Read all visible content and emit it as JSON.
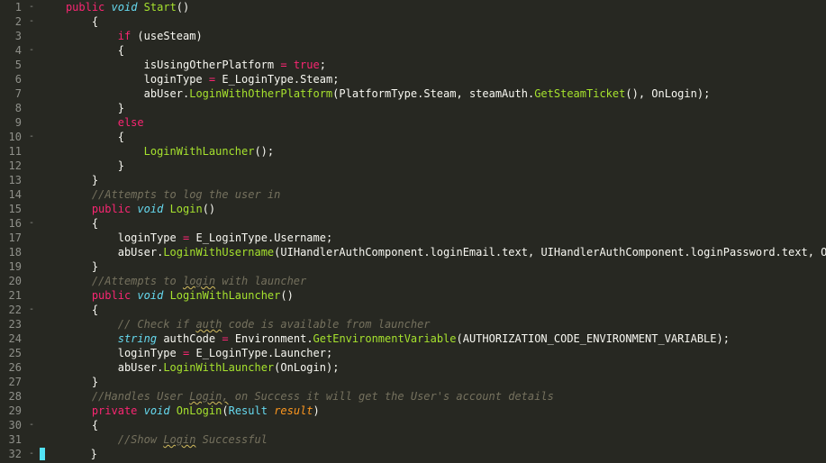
{
  "editor": {
    "language": "csharp",
    "theme": "monokai",
    "lines": [
      {
        "n": 1,
        "fold": "-",
        "html": "    <span class='kw'>public</span> <span class='type'>void</span> <span class='func'>Start</span><span class='paren'>()</span>"
      },
      {
        "n": 2,
        "fold": "-",
        "html": "        <span class='punc'>{</span>"
      },
      {
        "n": 3,
        "fold": "",
        "html": "            <span class='kw'>if</span> <span class='paren'>(</span><span class='ident'>useSteam</span><span class='paren'>)</span>"
      },
      {
        "n": 4,
        "fold": "-",
        "html": "            <span class='punc'>{</span>"
      },
      {
        "n": 5,
        "fold": "",
        "html": "                <span class='ident'>isUsingOtherPlatform</span> <span class='op'>=</span> <span class='kw'>true</span><span class='punc'>;</span>"
      },
      {
        "n": 6,
        "fold": "",
        "html": "                <span class='ident'>loginType</span> <span class='op'>=</span> <span class='ident'>E_LoginType</span><span class='punc'>.</span><span class='ident'>Steam</span><span class='punc'>;</span>"
      },
      {
        "n": 7,
        "fold": "",
        "html": "                <span class='ident'>abUser</span><span class='punc'>.</span><span class='func'>LoginWithOtherPlatform</span><span class='paren'>(</span><span class='ident'>PlatformType</span><span class='punc'>.</span><span class='ident'>Steam</span><span class='punc'>,</span> <span class='ident'>steamAuth</span><span class='punc'>.</span><span class='func'>GetSteamTicket</span><span class='paren'>()</span><span class='punc'>,</span> <span class='ident'>OnLogin</span><span class='paren'>)</span><span class='punc'>;</span>"
      },
      {
        "n": 8,
        "fold": "",
        "html": "            <span class='punc'>}</span>"
      },
      {
        "n": 9,
        "fold": "",
        "html": "            <span class='kw'>else</span>"
      },
      {
        "n": 10,
        "fold": "-",
        "html": "            <span class='punc'>{</span>"
      },
      {
        "n": 11,
        "fold": "",
        "html": "                <span class='func'>LoginWithLauncher</span><span class='paren'>()</span><span class='punc'>;</span>"
      },
      {
        "n": 12,
        "fold": "",
        "html": "            <span class='punc'>}</span>"
      },
      {
        "n": 13,
        "fold": "",
        "html": "        <span class='punc'>}</span>"
      },
      {
        "n": 14,
        "fold": "",
        "html": "        <span class='cmt'>//Attempts to log the user in</span>"
      },
      {
        "n": 15,
        "fold": "",
        "html": "        <span class='kw'>public</span> <span class='type'>void</span> <span class='func'>Login</span><span class='paren'>()</span>"
      },
      {
        "n": 16,
        "fold": "-",
        "html": "        <span class='punc'>{</span>"
      },
      {
        "n": 17,
        "fold": "",
        "html": "            <span class='ident'>loginType</span> <span class='op'>=</span> <span class='ident'>E_LoginType</span><span class='punc'>.</span><span class='ident'>Username</span><span class='punc'>;</span>"
      },
      {
        "n": 18,
        "fold": "",
        "html": "            <span class='ident'>abUser</span><span class='punc'>.</span><span class='func'>LoginWithUsername</span><span class='paren'>(</span><span class='ident'>UIHandlerAuthComponent</span><span class='punc'>.</span><span class='ident'>loginEmail</span><span class='punc'>.</span><span class='ident'>text</span><span class='punc'>,</span> <span class='ident'>UIHandlerAuthComponent</span><span class='punc'>.</span><span class='ident'>loginPassword</span><span class='punc'>.</span><span class='ident'>text</span><span class='punc'>,</span> <span class='ident'>OnLogin</span><span class='paren'>)</span><span class='punc'>;</span>"
      },
      {
        "n": 19,
        "fold": "",
        "html": "        <span class='punc'>}</span>"
      },
      {
        "n": 20,
        "fold": "",
        "html": "        <span class='cmt'>//Attempts to <span class='squiggle'>login</span> with launcher</span>"
      },
      {
        "n": 21,
        "fold": "",
        "html": "        <span class='kw'>public</span> <span class='type'>void</span> <span class='func'>LoginWithLauncher</span><span class='paren'>()</span>"
      },
      {
        "n": 22,
        "fold": "-",
        "html": "        <span class='punc'>{</span>"
      },
      {
        "n": 23,
        "fold": "",
        "html": "            <span class='cmt'>// Check if <span class='squiggle'>auth</span> code is available from launcher</span>"
      },
      {
        "n": 24,
        "fold": "",
        "html": "            <span class='type'>string</span> <span class='ident'>authCode</span> <span class='op'>=</span> <span class='ident'>Environment</span><span class='punc'>.</span><span class='func'>GetEnvironmentVariable</span><span class='paren'>(</span><span class='ident'>AUTHORIZATION_CODE_ENVIRONMENT_VARIABLE</span><span class='paren'>)</span><span class='punc'>;</span>"
      },
      {
        "n": 25,
        "fold": "",
        "html": "            <span class='ident'>loginType</span> <span class='op'>=</span> <span class='ident'>E_LoginType</span><span class='punc'>.</span><span class='ident'>Launcher</span><span class='punc'>;</span>"
      },
      {
        "n": 26,
        "fold": "",
        "html": "            <span class='ident'>abUser</span><span class='punc'>.</span><span class='func'>LoginWithLauncher</span><span class='paren'>(</span><span class='ident'>OnLogin</span><span class='paren'>)</span><span class='punc'>;</span>"
      },
      {
        "n": 27,
        "fold": "",
        "html": "        <span class='punc'>}</span>"
      },
      {
        "n": 28,
        "fold": "",
        "html": "        <span class='cmt'>//Handles User <span class='squiggle'>Login,</span> on Success it will get the User's account details</span>"
      },
      {
        "n": 29,
        "fold": "",
        "html": "        <span class='kw'>private</span> <span class='type'>void</span> <span class='func'>OnLogin</span><span class='paren'>(</span><span class='typeN'>Result</span> <span class='par'>result</span><span class='paren'>)</span>"
      },
      {
        "n": 30,
        "fold": "-",
        "html": "        <span class='punc'>{</span>"
      },
      {
        "n": 31,
        "fold": "",
        "html": "            <span class='cmt'>//Show <span class='squiggle'>Login</span> Successful</span>"
      },
      {
        "n": 32,
        "fold": "-",
        "html": "<span class='cursor'></span>       <span class='punc'>}</span>"
      }
    ],
    "source_plain": [
      "    public void Start()",
      "        {",
      "            if (useSteam)",
      "            {",
      "                isUsingOtherPlatform = true;",
      "                loginType = E_LoginType.Steam;",
      "                abUser.LoginWithOtherPlatform(PlatformType.Steam, steamAuth.GetSteamTicket(), OnLogin);",
      "            }",
      "            else",
      "            {",
      "                LoginWithLauncher();",
      "            }",
      "        }",
      "        //Attempts to log the user in",
      "        public void Login()",
      "        {",
      "            loginType = E_LoginType.Username;",
      "            abUser.LoginWithUsername(UIHandlerAuthComponent.loginEmail.text, UIHandlerAuthComponent.loginPassword.text, OnLogin);",
      "        }",
      "        //Attempts to login with launcher",
      "        public void LoginWithLauncher()",
      "        {",
      "            // Check if auth code is available from launcher",
      "            string authCode = Environment.GetEnvironmentVariable(AUTHORIZATION_CODE_ENVIRONMENT_VARIABLE);",
      "            loginType = E_LoginType.Launcher;",
      "            abUser.LoginWithLauncher(OnLogin);",
      "        }",
      "        //Handles User Login, on Success it will get the User's account details",
      "        private void OnLogin(Result result)",
      "        {",
      "            //Show Login Successful",
      "        }"
    ]
  }
}
